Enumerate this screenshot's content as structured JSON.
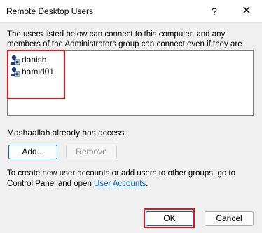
{
  "window": {
    "title": "Remote Desktop Users",
    "help_label": "?",
    "close_label": "✕"
  },
  "description": "The users listed below can connect to this computer, and any members of the Administrators group can connect even if they are not listed.",
  "users": [
    {
      "name": "danish",
      "icon": "user-icon"
    },
    {
      "name": "hamid01",
      "icon": "user-icon"
    }
  ],
  "access_text": "Mashaallah already has access.",
  "buttons": {
    "add": "Add...",
    "remove": "Remove",
    "ok": "OK",
    "cancel": "Cancel"
  },
  "info": {
    "text_before": "To create new user accounts or add users to other groups, go to Control Panel and open ",
    "link": "User Accounts",
    "text_after": "."
  },
  "colors": {
    "highlight": "#e0161b",
    "link": "#0066cc",
    "accent": "#0067c0"
  }
}
